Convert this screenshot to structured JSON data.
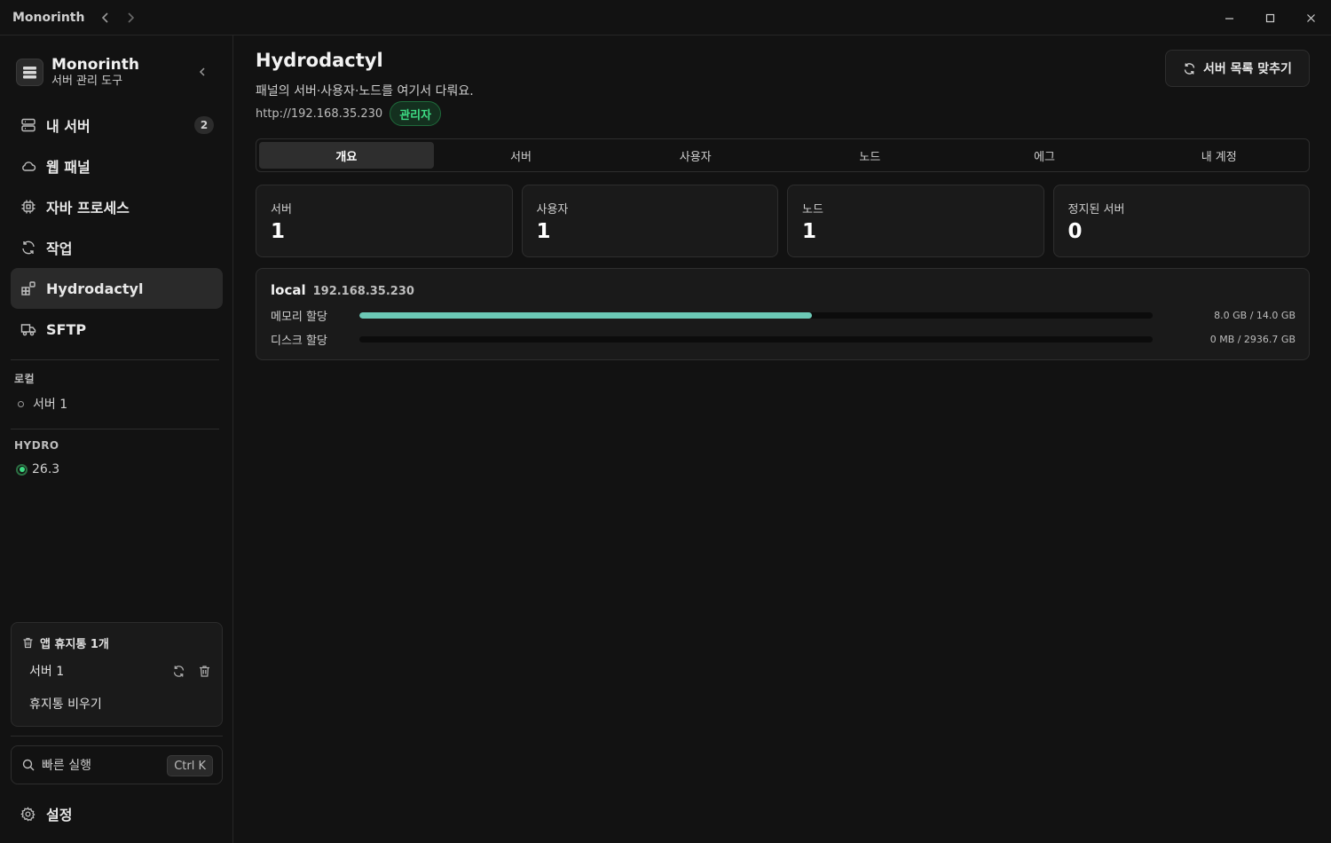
{
  "titlebar": {
    "app_name": "Monorinth"
  },
  "brand": {
    "title": "Monorinth",
    "subtitle": "서버 관리 도구"
  },
  "nav": [
    {
      "label": "내 서버",
      "icon": "server-icon",
      "badge": "2"
    },
    {
      "label": "웹 패널",
      "icon": "cloud-icon"
    },
    {
      "label": "자바 프로세스",
      "icon": "cpu-icon"
    },
    {
      "label": "작업",
      "icon": "refresh-icon"
    },
    {
      "label": "Hydrodactyl",
      "icon": "grid-plus-icon",
      "active": true
    },
    {
      "label": "SFTP",
      "icon": "truck-icon"
    }
  ],
  "groups": {
    "local": {
      "label": "로컬",
      "server": "서버 1"
    },
    "hydro": {
      "label": "HYDRO",
      "server": "26.3"
    }
  },
  "trash": {
    "title": "앱 휴지통 1개",
    "item": "서버 1",
    "empty_label": "휴지통 비우기"
  },
  "quick_run": {
    "placeholder": "빠른 실행",
    "shortcut": "Ctrl K"
  },
  "settings_label": "설정",
  "page": {
    "title": "Hydrodactyl",
    "description": "패널의 서버·사용자·노드를 여기서 다뤄요.",
    "url": "http://192.168.35.230",
    "role": "관리자",
    "sync_button": "서버 목록 맞추기"
  },
  "tabs": [
    {
      "label": "개요",
      "active": true
    },
    {
      "label": "서버"
    },
    {
      "label": "사용자"
    },
    {
      "label": "노드"
    },
    {
      "label": "에그"
    },
    {
      "label": "내 계정"
    }
  ],
  "stats": [
    {
      "label": "서버",
      "value": "1"
    },
    {
      "label": "사용자",
      "value": "1"
    },
    {
      "label": "노드",
      "value": "1"
    },
    {
      "label": "정지된 서버",
      "value": "0"
    }
  ],
  "node": {
    "name": "local",
    "ip": "192.168.35.230",
    "memory": {
      "label": "메모리 할당",
      "value": "8.0 GB / 14.0 GB",
      "fraction": 0.571
    },
    "disk": {
      "label": "디스크 할당",
      "value": "0 MB / 2936.7 GB",
      "fraction": 0
    }
  },
  "colors": {
    "accent_bar": "#6cc9b6",
    "status_green": "#3ddc84"
  }
}
